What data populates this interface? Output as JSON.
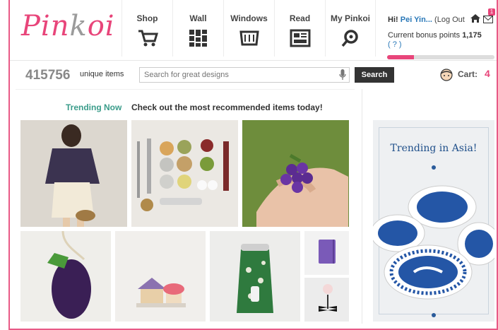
{
  "brand": {
    "logo_text_a": "Pin",
    "logo_text_b": "k",
    "logo_text_c": "oi"
  },
  "nav": [
    {
      "label": "Shop",
      "icon": "cart-icon"
    },
    {
      "label": "Wall",
      "icon": "grid-icon"
    },
    {
      "label": "Windows",
      "icon": "storefront-icon"
    },
    {
      "label": "Read",
      "icon": "reader-icon"
    },
    {
      "label": "My Pinkoi",
      "icon": "profile-icon"
    }
  ],
  "user": {
    "greeting": "Hi!",
    "name": "Pei Yin...",
    "logout": "(Log Out",
    "bonus_label": "Current bonus points",
    "bonus_value": "1,175",
    "help": "( ? )",
    "mail_count": "1",
    "bonus_progress": 0.25
  },
  "search": {
    "item_count": "415756",
    "item_count_label": "unique items",
    "placeholder": "Search for great designs",
    "button": "Search"
  },
  "cart": {
    "label": "Cart:",
    "count": "4"
  },
  "trending": {
    "heading": "Trending Now",
    "subheading": "Check out the most recommended items today!"
  },
  "ad": {
    "title": "Trending in Asia!"
  },
  "colors": {
    "brand": "#e8457a",
    "accent_teal": "#3a9c8a",
    "link_blue": "#2a78b8"
  }
}
